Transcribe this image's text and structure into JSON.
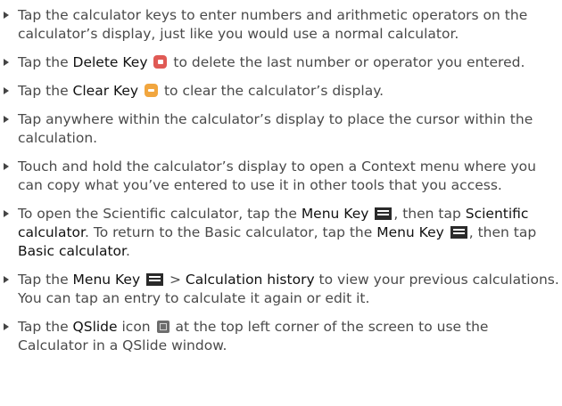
{
  "items": [
    {
      "text": "Tap the calculator keys to enter numbers and arithmetic operators on the calculator’s display, just like you would use a normal calculator."
    },
    {
      "pre": "Tap the ",
      "key": "Delete Key",
      "post": " to delete the last number or operator you entered."
    },
    {
      "pre": "Tap the ",
      "key": "Clear Key",
      "post": " to clear the calculator’s display."
    },
    {
      "text": "Tap anywhere within the calculator’s display to place the cursor within the calculation."
    },
    {
      "text": "Touch and hold the calculator’s display to open a Context menu where you can copy what you’ve entered to use it in other tools that you access."
    },
    {
      "pre": "To open the Scientific calculator, tap the ",
      "key1": "Menu Key",
      "mid1": ", then tap ",
      "bold1": "Scientific calculator",
      "mid2": ". To return to the Basic calculator, tap the ",
      "key2": "Menu Key",
      "mid3": ", then tap ",
      "bold2": "Basic calculator",
      "post": "."
    },
    {
      "pre": "Tap the ",
      "key": "Menu Key",
      "sep": " > ",
      "bold": "Calculation history",
      "post": " to view your previous calculations. You can tap an entry to calculate it again or edit it."
    },
    {
      "pre": "Tap the ",
      "key": "QSlide",
      "post": " icon ",
      "post2": " at the top left corner of the screen to use the Calculator in a QSlide window."
    }
  ],
  "icons": {
    "delete_key": "delete-key-icon",
    "clear_key": "clear-key-icon",
    "menu_key": "menu-key-icon",
    "qslide": "qslide-icon"
  },
  "colors": {
    "delete_key": "#e05a55",
    "clear_key": "#f1a63f",
    "menu_key": "#2a2a2a"
  }
}
